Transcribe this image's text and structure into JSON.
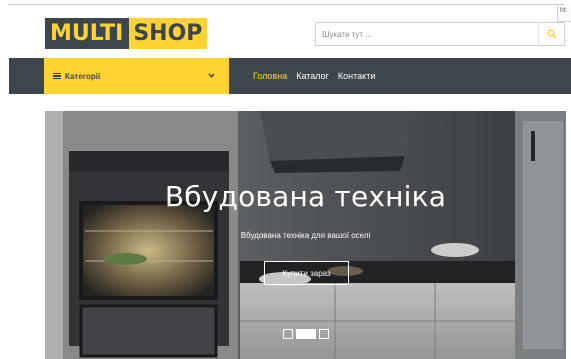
{
  "logo": {
    "part1": "MULTI",
    "part2": "SHOP"
  },
  "search": {
    "placeholder": "Шукати тут ..."
  },
  "nav": {
    "categories_label": "Категорії",
    "links": [
      "Головна",
      "Каталог",
      "Контакти"
    ],
    "active_link": "Головна"
  },
  "hero": {
    "title": "Вбудована техніка",
    "subtitle": "Вбудована техніка для вашої оселі",
    "button_label": "Купити зараз",
    "slides": 3,
    "active_slide": 2
  },
  "corner_tab": "ht",
  "colors": {
    "accent": "#FFD333",
    "dark": "#3D464D"
  },
  "icons": [
    "menu-bars-icon",
    "chevron-down-icon",
    "search-icon"
  ]
}
